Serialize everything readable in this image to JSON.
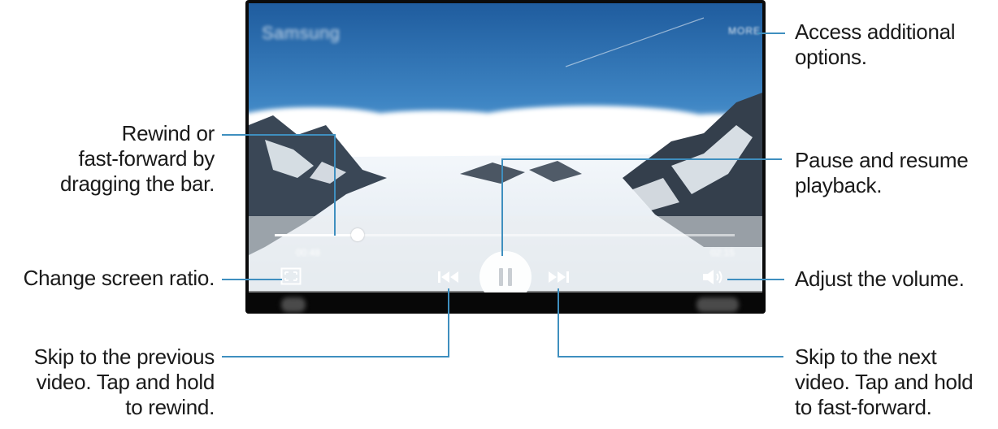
{
  "player": {
    "title": "Samsung",
    "more_label": "MORE",
    "time_elapsed": "00:48",
    "time_total": "02:15",
    "progress": 0.18
  },
  "icons": {
    "ratio": "screen-ratio-icon",
    "previous": "skip-previous-icon",
    "pause": "pause-icon",
    "next": "skip-next-icon",
    "volume": "volume-icon"
  },
  "callouts": {
    "more_options": [
      "Access additional",
      "options."
    ],
    "seek": [
      "Rewind or",
      "fast-forward by",
      "dragging the bar."
    ],
    "pause": [
      "Pause and resume",
      "playback."
    ],
    "ratio": [
      "Change screen ratio."
    ],
    "volume": [
      "Adjust the volume."
    ],
    "previous": [
      "Skip to the previous",
      "video. Tap and hold",
      "to rewind."
    ],
    "next": [
      "Skip to the next",
      "video. Tap and hold",
      "to fast-forward."
    ]
  },
  "colors": {
    "leader": "#3f8fbf",
    "sky_top": "#1e5a9b",
    "sky_mid": "#4a8cc6"
  }
}
